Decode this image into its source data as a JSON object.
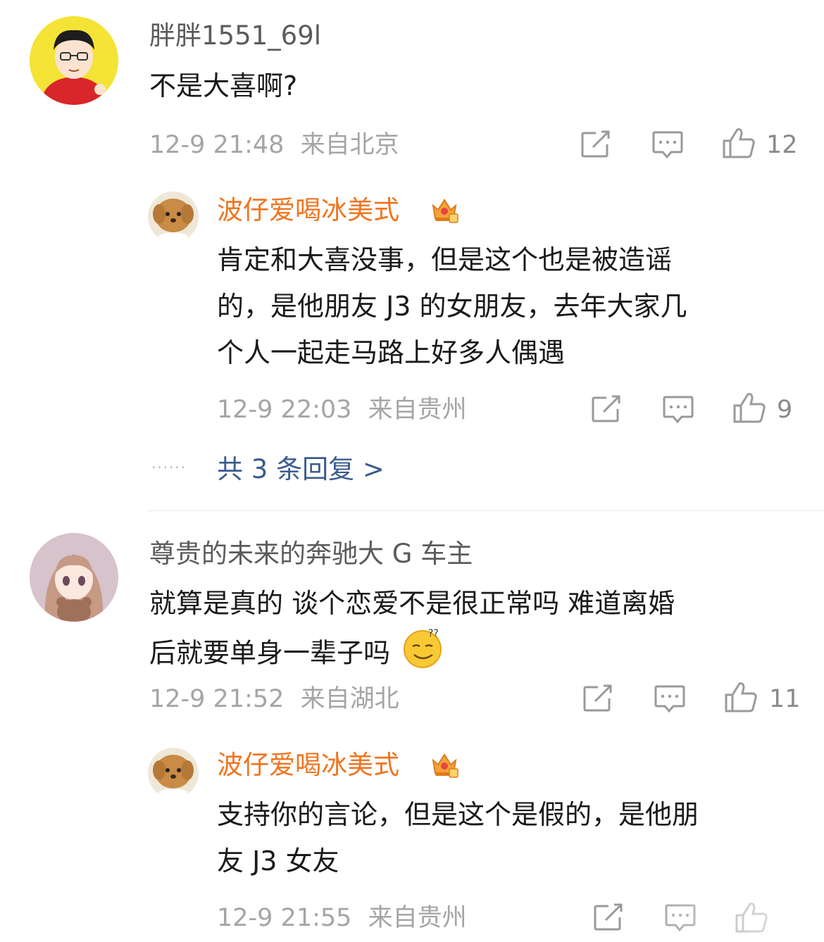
{
  "comments": [
    {
      "user": "胖胖1551_69l",
      "text_lines": [
        "不是大喜啊?"
      ],
      "time": "12-9 21:48",
      "location": "来自北京",
      "likes": "12",
      "reply": {
        "user": "波仔爱喝冰美式",
        "text_lines": [
          "肯定和大喜没事，但是这个也是被造谣",
          "的，是他朋友 J3 的女朋友，去年大家几",
          "个人一起走马路上好多人偶遇"
        ],
        "time": "12-9 22:03",
        "location": "来自贵州",
        "likes": "9"
      },
      "more_replies": "共 3 条回复 >"
    },
    {
      "user": "尊贵的未来的奔驰大 G 车主",
      "text_lines": [
        "就算是真的 谈个恋爱不是很正常吗  难道离婚",
        "后就要单身一辈子吗"
      ],
      "time": "12-9 21:52",
      "location": "来自湖北",
      "likes": "11",
      "reply": {
        "user": "波仔爱喝冰美式",
        "text_lines": [
          "支持你的言论，但是这个是假的，是他朋",
          "友 J3 女友"
        ],
        "time": "12-9 21:55",
        "location": "来自贵州"
      }
    }
  ],
  "colors": {
    "username_gray": "#5b5b5b",
    "username_orange": "#f0741f",
    "meta_gray": "#a5a5a5",
    "link_blue": "#3a5c8c"
  },
  "icons": [
    "share-icon",
    "comment-icon",
    "like-icon",
    "crown-badge-icon",
    "avatar-cartoon-man",
    "avatar-puppy",
    "avatar-anime-girl",
    "emoji-confused-smile"
  ]
}
